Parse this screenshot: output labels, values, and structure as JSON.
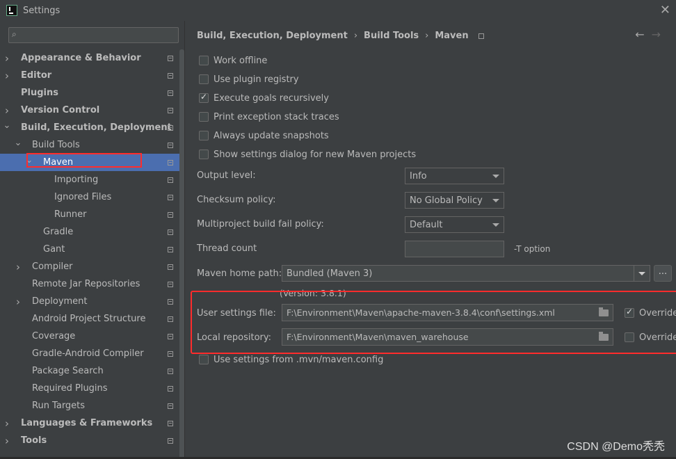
{
  "window": {
    "title": "Settings",
    "app_icon": "intellij-icon",
    "close_icon": "close-icon"
  },
  "sidebar": {
    "search_placeholder": "",
    "items": [
      {
        "label": "Appearance & Behavior",
        "level": 0,
        "arrow": "right",
        "bold": true
      },
      {
        "label": "Editor",
        "level": 0,
        "arrow": "right",
        "bold": true
      },
      {
        "label": "Plugins",
        "level": 0,
        "arrow": "none",
        "bold": true
      },
      {
        "label": "Version Control",
        "level": 0,
        "arrow": "right",
        "bold": true
      },
      {
        "label": "Build, Execution, Deployment",
        "level": 0,
        "arrow": "down",
        "bold": true
      },
      {
        "label": "Build Tools",
        "level": 1,
        "arrow": "down",
        "bold": false
      },
      {
        "label": "Maven",
        "level": 2,
        "arrow": "down",
        "bold": false,
        "selected": true
      },
      {
        "label": "Importing",
        "level": 3,
        "arrow": "none",
        "bold": false
      },
      {
        "label": "Ignored Files",
        "level": 3,
        "arrow": "none",
        "bold": false
      },
      {
        "label": "Runner",
        "level": 3,
        "arrow": "none",
        "bold": false
      },
      {
        "label": "Gradle",
        "level": 2,
        "arrow": "none",
        "bold": false
      },
      {
        "label": "Gant",
        "level": 2,
        "arrow": "none",
        "bold": false
      },
      {
        "label": "Compiler",
        "level": 1,
        "arrow": "right",
        "bold": false
      },
      {
        "label": "Remote Jar Repositories",
        "level": 1,
        "arrow": "none",
        "bold": false
      },
      {
        "label": "Deployment",
        "level": 1,
        "arrow": "right",
        "bold": false
      },
      {
        "label": "Android Project Structure",
        "level": 1,
        "arrow": "none",
        "bold": false
      },
      {
        "label": "Coverage",
        "level": 1,
        "arrow": "none",
        "bold": false
      },
      {
        "label": "Gradle-Android Compiler",
        "level": 1,
        "arrow": "none",
        "bold": false
      },
      {
        "label": "Package Search",
        "level": 1,
        "arrow": "none",
        "bold": false
      },
      {
        "label": "Required Plugins",
        "level": 1,
        "arrow": "none",
        "bold": false
      },
      {
        "label": "Run Targets",
        "level": 1,
        "arrow": "none",
        "bold": false
      },
      {
        "label": "Languages & Frameworks",
        "level": 0,
        "arrow": "right",
        "bold": true
      },
      {
        "label": "Tools",
        "level": 0,
        "arrow": "right",
        "bold": true
      }
    ]
  },
  "breadcrumb": {
    "parts": [
      "Build, Execution, Deployment",
      "Build Tools",
      "Maven"
    ],
    "separator": "›"
  },
  "nav": {
    "back": "←",
    "forward": "→"
  },
  "checkboxes": [
    {
      "label": "Work offline",
      "checked": false
    },
    {
      "label": "Use plugin registry",
      "checked": false
    },
    {
      "label": "Execute goals recursively",
      "checked": true
    },
    {
      "label": "Print exception stack traces",
      "checked": false
    },
    {
      "label": "Always update snapshots",
      "checked": false
    },
    {
      "label": "Show settings dialog for new Maven projects",
      "checked": false
    }
  ],
  "fields": {
    "output_level_label": "Output level:",
    "output_level_value": "Info",
    "checksum_label": "Checksum policy:",
    "checksum_value": "No Global Policy",
    "multiproject_label": "Multiproject build fail policy:",
    "multiproject_value": "Default",
    "thread_count_label": "Thread count",
    "thread_count_value": "",
    "thread_count_suffix": "-T option",
    "maven_home_label": "Maven home path:",
    "maven_home_value": "Bundled (Maven 3)",
    "maven_home_browse": "...",
    "version_text": "(Version: 3.8.1)",
    "user_settings_label": "User settings file:",
    "user_settings_value": "F:\\Environment\\Maven\\apache-maven-3.8.4\\conf\\settings.xml",
    "user_settings_override": "Override",
    "user_settings_override_checked": true,
    "local_repo_label": "Local repository:",
    "local_repo_value": "F:\\Environment\\Maven\\maven_warehouse",
    "local_repo_override": "Override",
    "local_repo_override_checked": false,
    "mvn_config_label": "Use settings from .mvn/maven.config",
    "mvn_config_checked": false
  },
  "watermark": "CSDN @Demo秃秃",
  "colors": {
    "background": "#3c3f41",
    "selection": "#4b6eaf",
    "annotation": "#ff2c2c",
    "text": "#bbbbbb"
  }
}
